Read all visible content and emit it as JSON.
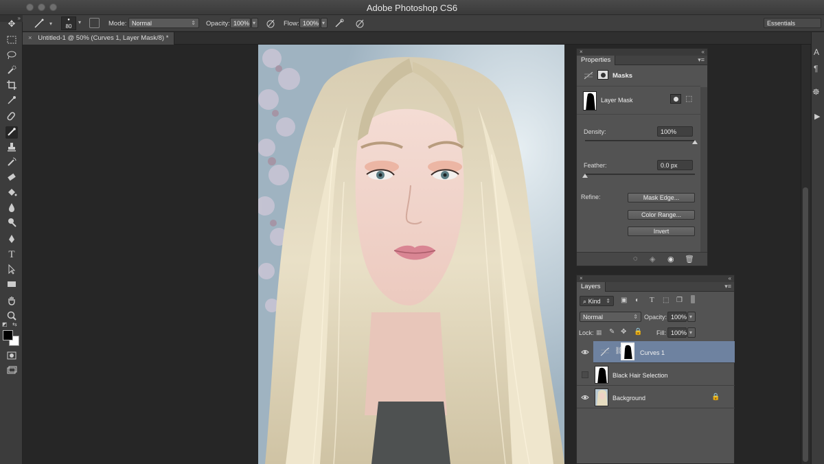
{
  "app": {
    "title": "Adobe Photoshop CS6"
  },
  "options_bar": {
    "brush_size": "80",
    "mode_label": "Mode:",
    "mode_value": "Normal",
    "opacity_label": "Opacity:",
    "opacity_value": "100%",
    "flow_label": "Flow:",
    "flow_value": "100%",
    "workspace": "Essentials"
  },
  "document_tab": {
    "label": "Untitled-1 @ 50% (Curves 1, Layer Mask/8) *"
  },
  "properties_panel": {
    "tab_label": "Properties",
    "section_label": "Masks",
    "mask_type": "Layer Mask",
    "density_label": "Density:",
    "density_value": "100%",
    "density_fraction": 1.0,
    "feather_label": "Feather:",
    "feather_value": "0.0 px",
    "feather_fraction": 0.0,
    "refine_label": "Refine:",
    "buttons": [
      "Mask Edge...",
      "Color Range...",
      "Invert"
    ]
  },
  "layers_panel": {
    "tab_label": "Layers",
    "filter_kind": "Kind",
    "blend_mode": "Normal",
    "opacity_label": "Opacity:",
    "opacity_value": "100%",
    "lock_label": "Lock:",
    "fill_label": "Fill:",
    "fill_value": "100%",
    "layers": [
      {
        "name": "Curves 1",
        "visible": true,
        "selected": true
      },
      {
        "name": "Black Hair Selection",
        "visible": false,
        "selected": false
      },
      {
        "name": "Background",
        "visible": true,
        "selected": false,
        "locked": true
      }
    ]
  },
  "colors": {
    "selection": "#6e82a0",
    "panel": "#535353",
    "workspace": "#262626"
  }
}
